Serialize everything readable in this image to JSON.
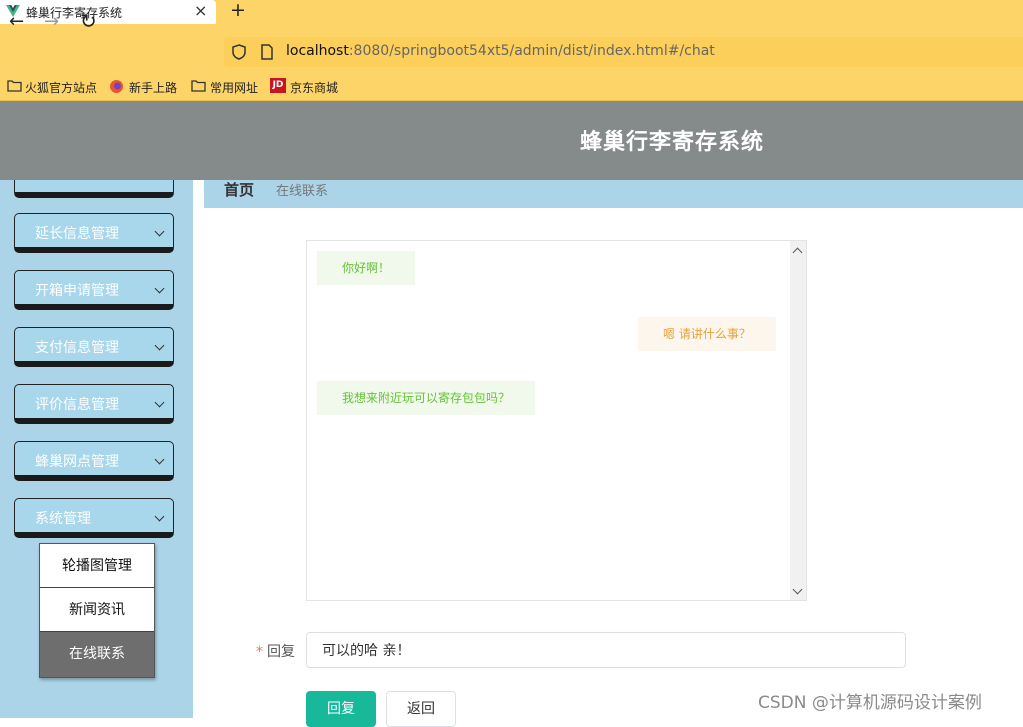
{
  "browser": {
    "tab_title": "蜂巢行李寄存系统",
    "tab_close": "×",
    "new_tab": "+",
    "url_host": "localhost",
    "url_path": ":8080/springboot54xt5/admin/dist/index.html#/chat",
    "bookmarks": [
      {
        "label": "火狐官方站点",
        "icon": "folder-icon"
      },
      {
        "label": "新手上路",
        "icon": "firefox-icon"
      },
      {
        "label": "常用网址",
        "icon": "folder-icon"
      },
      {
        "label": "京东商城",
        "icon": "jd-icon"
      }
    ],
    "jd_icon_text": "JD",
    "icons": {
      "back": "←",
      "forward": "→",
      "reload": "↻"
    }
  },
  "app": {
    "title": "蜂巢行李寄存系统"
  },
  "sidebar": {
    "menus": [
      {
        "label": "延长信息管理"
      },
      {
        "label": "开箱申请管理"
      },
      {
        "label": "支付信息管理"
      },
      {
        "label": "评价信息管理"
      },
      {
        "label": "蜂巢网点管理"
      },
      {
        "label": "系统管理"
      }
    ],
    "submenu": [
      {
        "label": "轮播图管理",
        "active": false
      },
      {
        "label": "新闻资讯",
        "active": false
      },
      {
        "label": "在线联系",
        "active": true
      }
    ]
  },
  "breadcrumb": {
    "home": "首页",
    "current": "在线联系"
  },
  "chat": {
    "messages": [
      {
        "side": "left",
        "text": "你好啊！"
      },
      {
        "side": "right",
        "text": "嗯 请讲什么事？"
      },
      {
        "side": "left",
        "text": "我想来附近玩可以寄存包包吗？"
      }
    ]
  },
  "form": {
    "required_mark": "*",
    "reply_label": "回复",
    "reply_value": "可以的哈 亲！",
    "reply_button": "回复",
    "back_button": "返回"
  },
  "watermark": "CSDN @计算机源码设计案例",
  "colors": {
    "browser_chrome": "#fdd468",
    "header": "#858a8b",
    "sidebar": "#acd4e8",
    "primary_button": "#18b99b",
    "left_bubble": "#f0f9eb",
    "right_bubble": "#fdf6ec"
  }
}
